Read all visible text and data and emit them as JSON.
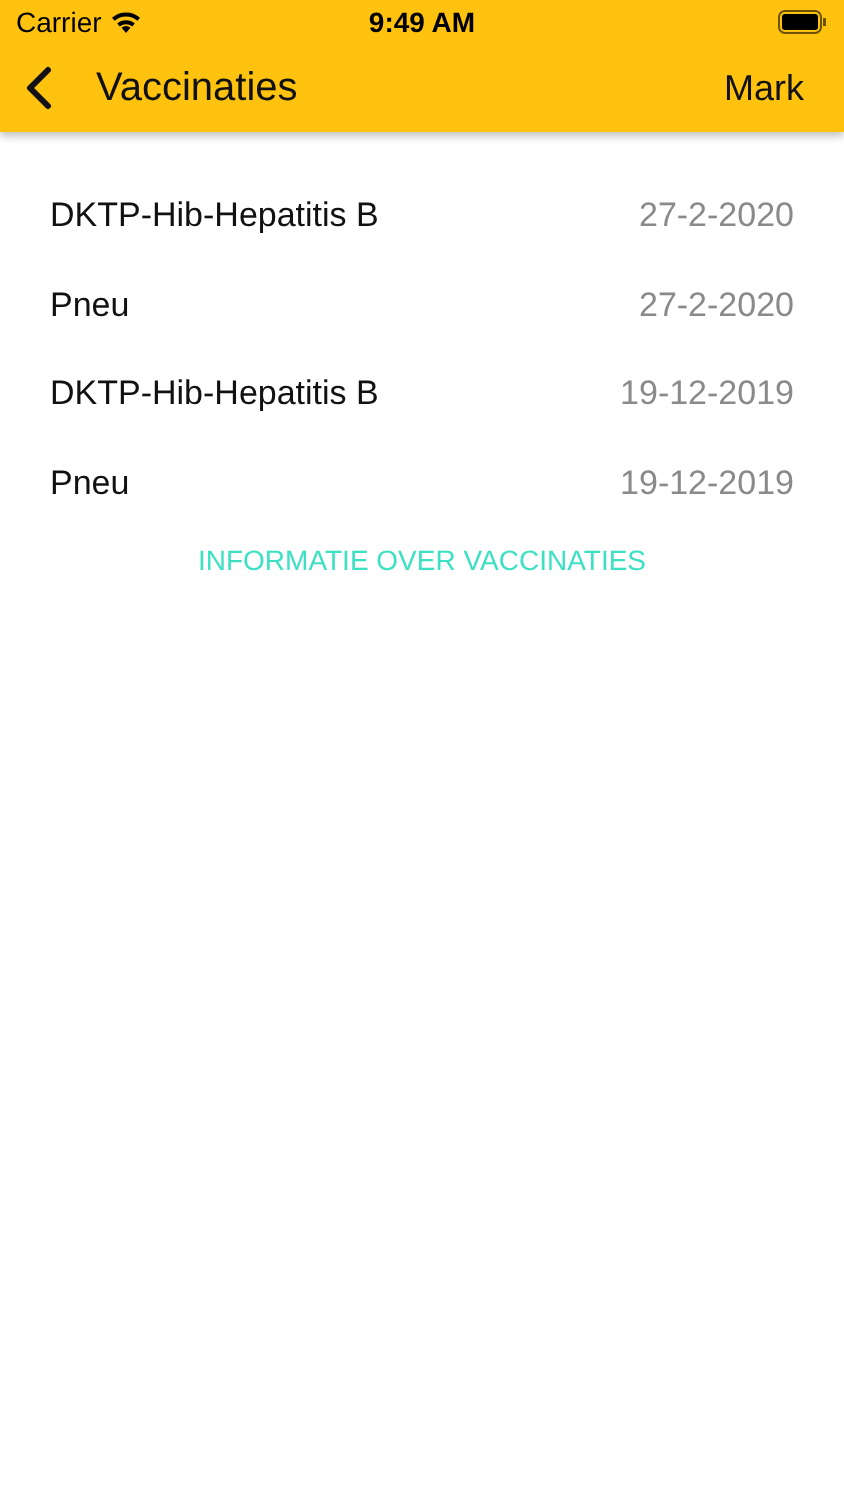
{
  "status_bar": {
    "carrier": "Carrier",
    "time": "9:49 AM"
  },
  "nav_bar": {
    "title": "Vaccinaties",
    "action": "Mark"
  },
  "vaccinations": [
    {
      "name": "DKTP-Hib-Hepatitis B",
      "date": "27-2-2020"
    },
    {
      "name": "Pneu",
      "date": "27-2-2020"
    },
    {
      "name": "DKTP-Hib-Hepatitis B",
      "date": "19-12-2019"
    },
    {
      "name": "Pneu",
      "date": "19-12-2019"
    }
  ],
  "info_link": "INFORMATIE OVER VACCINATIES"
}
